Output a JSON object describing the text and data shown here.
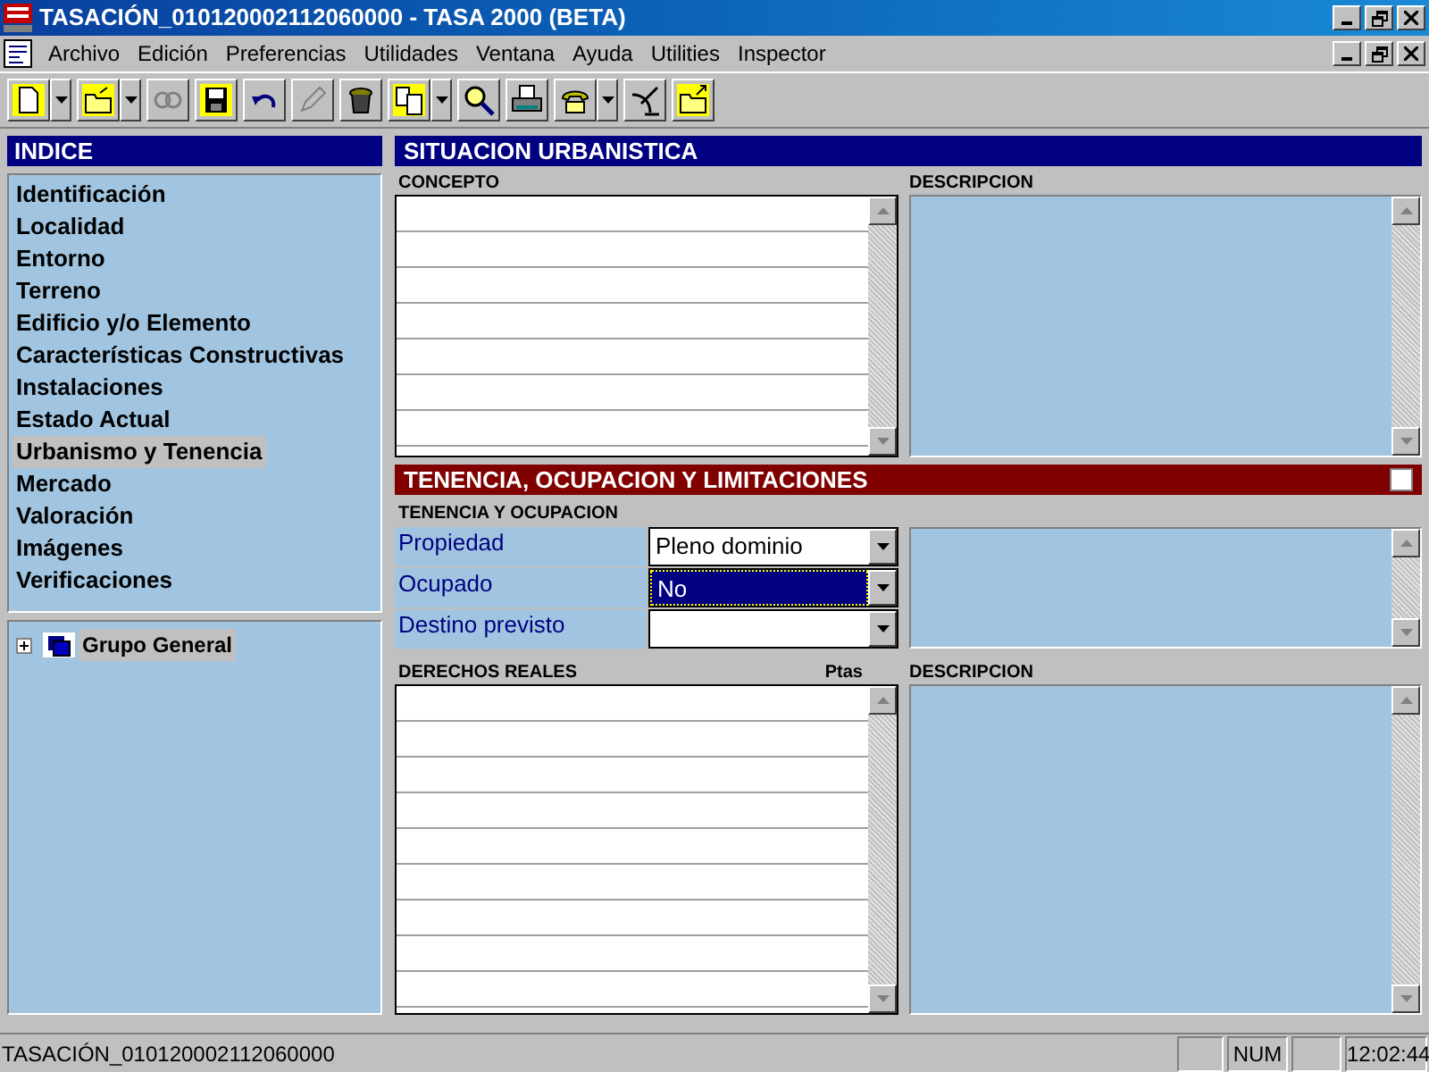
{
  "window": {
    "title": "TASACIÓN_010120002112060000 - TASA 2000 (BETA)"
  },
  "menu": [
    "Archivo",
    "Edición",
    "Preferencias",
    "Utilidades",
    "Ventana",
    "Ayuda",
    "Utilities",
    "Inspector"
  ],
  "toolbar": [
    {
      "kind": "new",
      "disabled": false,
      "dropdown": true
    },
    {
      "kind": "open",
      "disabled": false,
      "dropdown": true
    },
    {
      "kind": "link",
      "disabled": true,
      "dropdown": false
    },
    {
      "kind": "save",
      "disabled": false,
      "dropdown": false
    },
    {
      "kind": "undo",
      "disabled": false,
      "dropdown": false
    },
    {
      "kind": "edit",
      "disabled": true,
      "dropdown": false
    },
    {
      "kind": "bin",
      "disabled": false,
      "dropdown": false
    },
    {
      "kind": "copy",
      "disabled": false,
      "dropdown": true
    },
    {
      "kind": "search",
      "disabled": false,
      "dropdown": false
    },
    {
      "kind": "print",
      "disabled": false,
      "dropdown": false
    },
    {
      "kind": "phone",
      "disabled": false,
      "dropdown": true
    },
    {
      "kind": "antenna",
      "disabled": false,
      "dropdown": false
    },
    {
      "kind": "export",
      "disabled": false,
      "dropdown": false
    }
  ],
  "index": {
    "title": "INDICE",
    "items": [
      {
        "label": "Identificación",
        "selected": false
      },
      {
        "label": "Localidad",
        "selected": false
      },
      {
        "label": "Entorno",
        "selected": false
      },
      {
        "label": "Terreno",
        "selected": false
      },
      {
        "label": "Edificio y/o Elemento",
        "selected": false
      },
      {
        "label": "Características Constructivas",
        "selected": false
      },
      {
        "label": "Instalaciones",
        "selected": false
      },
      {
        "label": "Estado Actual",
        "selected": false
      },
      {
        "label": "Urbanismo y Tenencia",
        "selected": true
      },
      {
        "label": "Mercado",
        "selected": false
      },
      {
        "label": "Valoración",
        "selected": false
      },
      {
        "label": "Imágenes",
        "selected": false
      },
      {
        "label": "Verificaciones",
        "selected": false
      }
    ]
  },
  "tree": [
    {
      "label": "Grupo General",
      "expanded": false,
      "selected": true
    }
  ],
  "situacion": {
    "title": "SITUACION URBANISTICA",
    "concept_heading": "CONCEPTO",
    "description_heading": "DESCRIPCION"
  },
  "tenencia": {
    "title": "TENENCIA, OCUPACION Y LIMITACIONES",
    "checked": false,
    "subtitle": "TENENCIA Y OCUPACION",
    "fields": [
      {
        "label": "Propiedad",
        "value": "Pleno dominio",
        "selected": false
      },
      {
        "label": "Ocupado",
        "value": "No",
        "selected": true
      },
      {
        "label": "Destino previsto",
        "selected": false
      }
    ],
    "rights_heading": "DERECHOS REALES",
    "rights_unit": "Ptas",
    "description_heading": "DESCRIPCION"
  },
  "status_bar": {
    "text": "TASACIÓN_010120002112060000",
    "num_indicator": "NUM",
    "clock": "12:02:44"
  }
}
